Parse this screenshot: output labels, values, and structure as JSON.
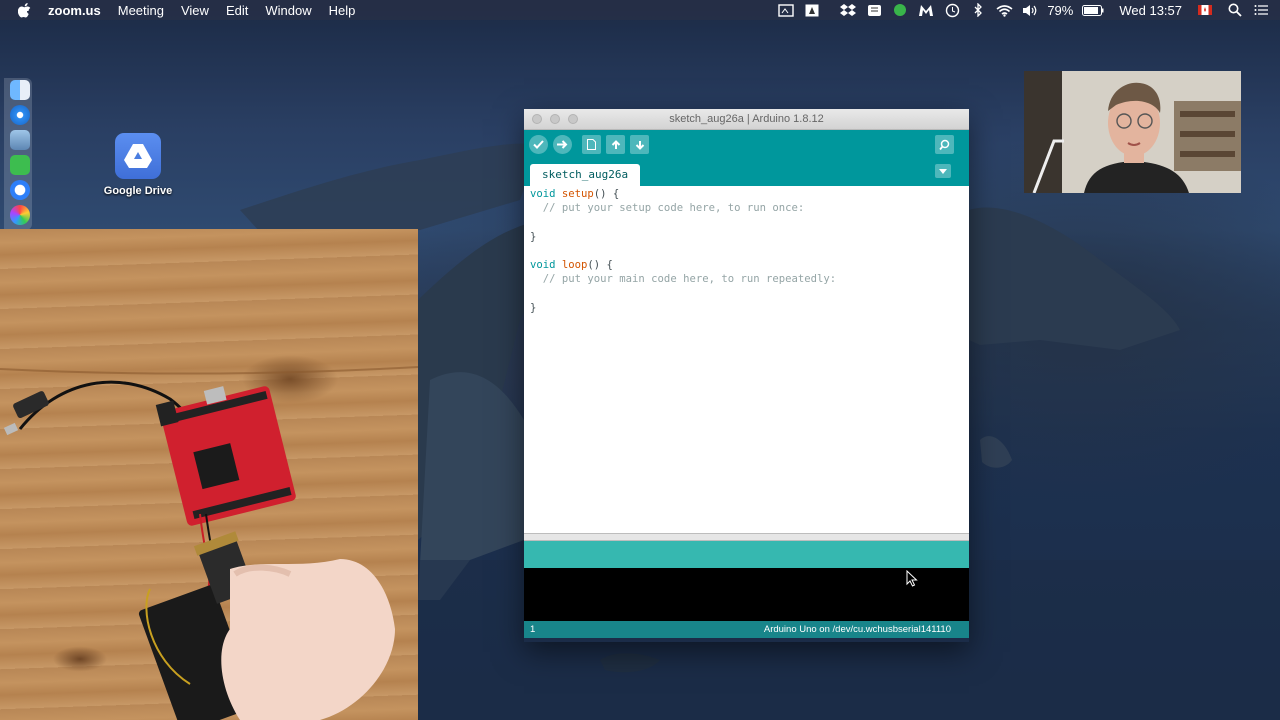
{
  "menubar": {
    "app_name": "zoom.us",
    "items": [
      "Meeting",
      "View",
      "Edit",
      "Window",
      "Help"
    ],
    "battery": "79%",
    "clock": "Wed 13:57"
  },
  "desktop": {
    "icons": [
      {
        "label": "Google Drive",
        "icon": "google-drive-icon"
      }
    ]
  },
  "ide": {
    "window_title": "sketch_aug26a | Arduino 1.8.12",
    "tab_label": "sketch_aug26a",
    "code": {
      "l1_kw": "void",
      "l1_fn": "setup",
      "l1_rest": "() {",
      "l2": "  // put your setup code here, to run once:",
      "l4": "}",
      "l6_kw": "void",
      "l6_fn": "loop",
      "l6_rest": "() {",
      "l7": "  // put your main code here, to run repeatedly:",
      "l9": "}"
    },
    "status": {
      "line_number": "1",
      "board_port": "Arduino Uno on /dev/cu.wchusbserial141110"
    },
    "colors": {
      "toolbar": "#00979c",
      "message_bar": "#36b8b0",
      "status_bar": "#18858a"
    }
  }
}
